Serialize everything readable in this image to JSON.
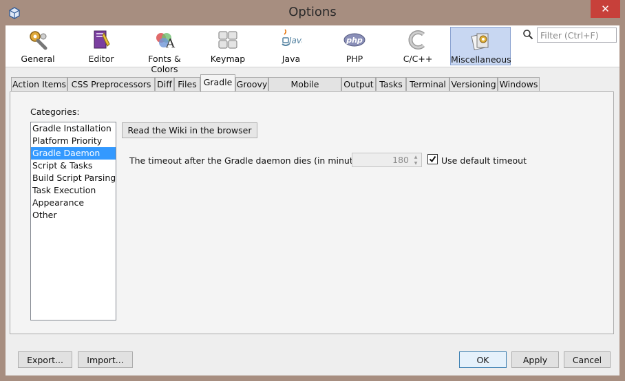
{
  "window": {
    "title": "Options",
    "close_symbol": "✕"
  },
  "toolbar": {
    "categories": [
      {
        "label": "General",
        "icon": "general-icon"
      },
      {
        "label": "Editor",
        "icon": "editor-icon"
      },
      {
        "label": "Fonts & Colors",
        "icon": "fonts-colors-icon"
      },
      {
        "label": "Keymap",
        "icon": "keymap-icon"
      },
      {
        "label": "Java",
        "icon": "java-icon"
      },
      {
        "label": "PHP",
        "icon": "php-icon"
      },
      {
        "label": "C/C++",
        "icon": "cpp-icon"
      },
      {
        "label": "Miscellaneous",
        "icon": "miscellaneous-icon",
        "selected": true
      }
    ],
    "search_placeholder": "Filter (Ctrl+F)",
    "java_text": "Java",
    "php_text": "php"
  },
  "tabs": [
    "Action Items",
    "CSS Preprocessors",
    "Diff",
    "Files",
    "Gradle",
    "Groovy",
    "Mobile Platforms",
    "Output",
    "Tasks",
    "Terminal",
    "Versioning",
    "Windows"
  ],
  "active_tab": "Gradle",
  "gradle": {
    "categories_label": "Categories:",
    "categories": [
      "Gradle Installation",
      "Platform Priority",
      "Gradle Daemon",
      "Script & Tasks",
      "Build Script Parsing",
      "Task Execution",
      "Appearance",
      "Other"
    ],
    "selected_category": "Gradle Daemon",
    "wiki_button": "Read the Wiki in the browser",
    "timeout_label": "The timeout after the Gradle daemon dies (in minutes):",
    "timeout_value": "180",
    "use_default_label": "Use default timeout",
    "use_default_checked": true
  },
  "buttons": {
    "export": "Export...",
    "import": "Import...",
    "ok": "OK",
    "apply": "Apply",
    "cancel": "Cancel"
  },
  "colors": {
    "title_bar": "#a78e80",
    "close": "#c7403a",
    "selection": "#3399ff",
    "toolbar_selected": "#c8d7f2"
  }
}
